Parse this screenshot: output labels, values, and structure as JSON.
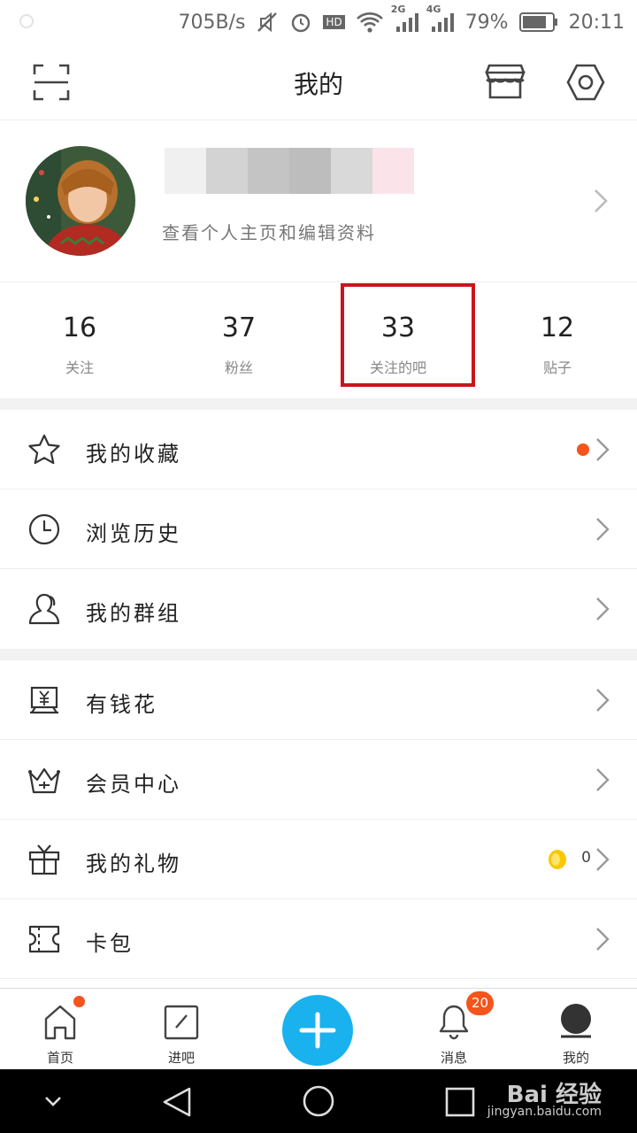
{
  "status_bar": {
    "net_speed": "705B/s",
    "hd": "HD",
    "net_2g": "2G",
    "net_4g": "4G",
    "battery": "79%",
    "time": "20:11"
  },
  "header": {
    "title": "我的"
  },
  "profile": {
    "subtitle": "查看个人主页和编辑资料"
  },
  "stats": [
    {
      "count": "16",
      "label": "关注"
    },
    {
      "count": "37",
      "label": "粉丝"
    },
    {
      "count": "33",
      "label": "关注的吧"
    },
    {
      "count": "12",
      "label": "贴子"
    }
  ],
  "menu_group_1": [
    {
      "label": "我的收藏",
      "icon": "star-icon"
    },
    {
      "label": "浏览历史",
      "icon": "clock-icon"
    },
    {
      "label": "我的群组",
      "icon": "person-icon"
    }
  ],
  "menu_group_2": [
    {
      "label": "有钱花",
      "icon": "money-icon"
    },
    {
      "label": "会员中心",
      "icon": "crown-icon"
    },
    {
      "label": "我的礼物",
      "icon": "gift-icon",
      "coin_count": "0"
    },
    {
      "label": "卡包",
      "icon": "ticket-icon"
    }
  ],
  "tabbar": {
    "home": "首页",
    "enter": "进吧",
    "messages": "消息",
    "messages_badge": "20",
    "mine": "我的"
  },
  "watermark": {
    "brand": "Bai 经验",
    "url": "jingyan.baidu.com"
  },
  "colors": {
    "accent_blue": "#1ab1ef",
    "badge_orange": "#f5541c",
    "highlight_red": "#c8161d"
  }
}
